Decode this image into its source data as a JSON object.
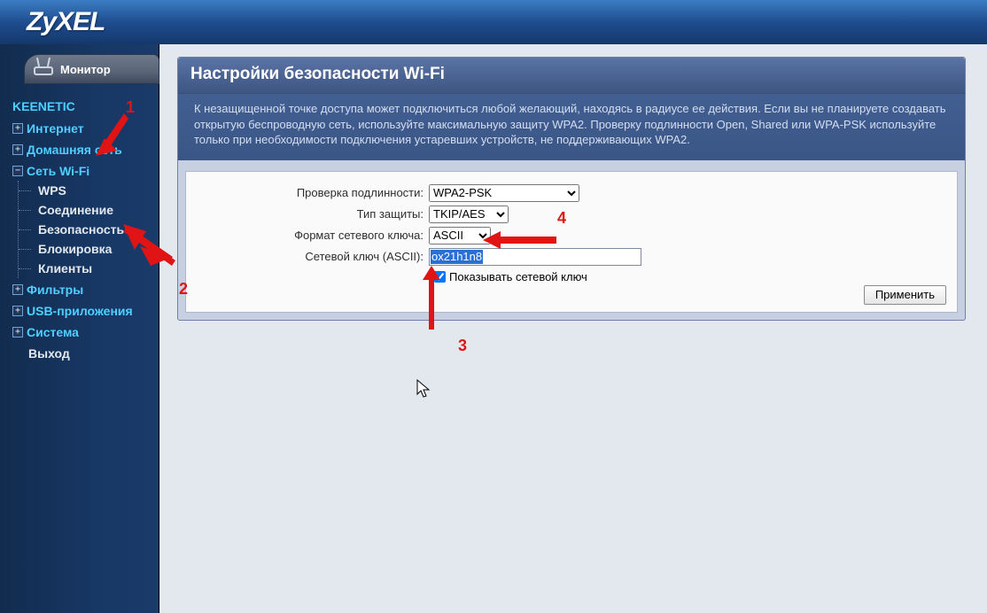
{
  "brand": "ZyXEL",
  "sidebar": {
    "monitor_label": "Монитор",
    "device": "KEENETIC",
    "groups": {
      "internet": "Интернет",
      "home": "Домашняя сеть",
      "wifi": {
        "label": "Сеть Wi-Fi",
        "items": [
          "WPS",
          "Соединение",
          "Безопасность",
          "Блокировка",
          "Клиенты"
        ]
      },
      "filters": "Фильтры",
      "usb": "USB-приложения",
      "system": "Система",
      "exit": "Выход"
    }
  },
  "panel": {
    "title": "Настройки безопасности Wi-Fi",
    "description": "К незащищенной точке доступа может подключиться любой желающий, находясь в радиусе ее действия. Если вы не планируете создавать открытую беспроводную сеть, используйте максимальную защиту WPA2. Проверку подлинности Open, Shared или WPA-PSK используйте только при необходимости подключения устаревших устройств, не поддерживающих WPA2."
  },
  "form": {
    "auth_label": "Проверка подлинности:",
    "auth_value": "WPA2-PSK",
    "cipher_label": "Тип защиты:",
    "cipher_value": "TKIP/AES",
    "keyfmt_label": "Формат сетевого ключа:",
    "keyfmt_value": "ASCII",
    "key_label": "Сетевой ключ (ASCII):",
    "key_value": "ox21h1n8",
    "show_key_label": "Показывать сетевой ключ",
    "apply_label": "Применить"
  },
  "annotations": {
    "n1": "1",
    "n2": "2",
    "n3": "3",
    "n4": "4"
  }
}
